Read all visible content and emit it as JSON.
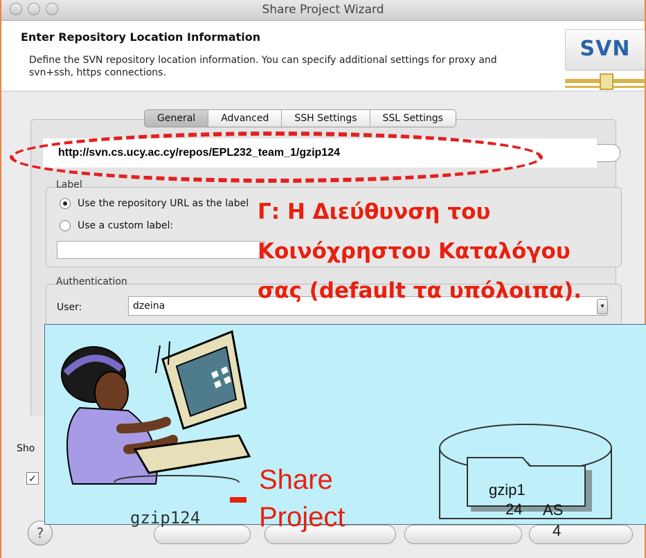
{
  "window": {
    "title": "Share Project Wizard"
  },
  "header": {
    "title": "Enter Repository Location Information",
    "description": "Define the SVN repository location information. You can specify additional settings for proxy and svn+ssh, https connections.",
    "logo_text": "SVN"
  },
  "tabs": [
    {
      "label": "General",
      "active": true
    },
    {
      "label": "Advanced",
      "active": false
    },
    {
      "label": "SSH Settings",
      "active": false
    },
    {
      "label": "SSL Settings",
      "active": false
    }
  ],
  "url": {
    "value": "http://svn.cs.ucy.ac.cy/repos/EPL232_team_1/gzip124"
  },
  "label_group": {
    "title": "Label",
    "option_url": "Use the repository URL as the label",
    "option_custom": "Use a custom label:",
    "custom_value": ""
  },
  "annotation": {
    "line1": "Γ: Η Διεύθυνση του",
    "line2": "Κοινόχρηστου Καταλόγου",
    "line3": "σας (default τα υπόλοιπα)."
  },
  "auth": {
    "title": "Authentication",
    "user_label": "User:",
    "user_value": "dzeina"
  },
  "footer": {
    "show_label_prefix": "Sho",
    "help": "?"
  },
  "diagram": {
    "share_line1": "Share",
    "share_line2": "Project",
    "local_folder": "gzip124",
    "repo_folder_line1": "gzip1",
    "repo_folder_line2": "24",
    "repo_folder2_line1": "AS",
    "repo_folder2_line2": "4"
  },
  "colors": {
    "annotation_red": "#e8200f",
    "overlay_bg": "#bff0fa",
    "svn_blue": "#2c63a8",
    "window_border": "#e9863f"
  }
}
